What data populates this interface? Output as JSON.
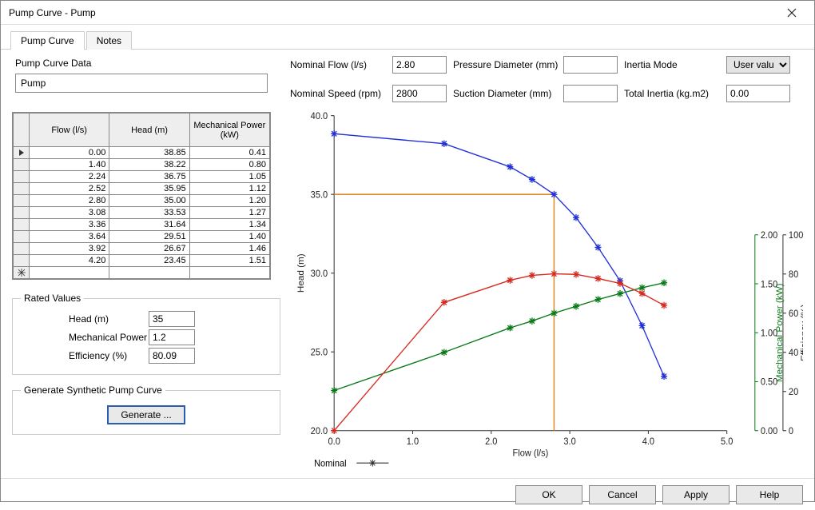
{
  "window": {
    "title": "Pump Curve - Pump"
  },
  "tabs": {
    "curve": "Pump Curve",
    "notes": "Notes"
  },
  "left": {
    "section_label": "Pump Curve Data",
    "name_value": "Pump",
    "grid": {
      "headers": {
        "flow": "Flow (l/s)",
        "head": "Head (m)",
        "power": "Mechanical Power (kW)"
      }
    },
    "rated": {
      "legend": "Rated Values",
      "head_label": "Head (m)",
      "head_value": "35",
      "power_label": "Mechanical Power",
      "power_value": "1.2",
      "eff_label": "Efficiency (%)",
      "eff_value": "80.09"
    },
    "gen": {
      "legend": "Generate Synthetic Pump Curve",
      "button": "Generate ..."
    }
  },
  "params": {
    "nominal_flow_label": "Nominal Flow (l/s)",
    "nominal_flow_value": "2.80",
    "pressure_dia_label": "Pressure Diameter (mm)",
    "pressure_dia_value": "",
    "inertia_mode_label": "Inertia Mode",
    "inertia_mode_value": "User value",
    "nominal_speed_label": "Nominal Speed (rpm)",
    "nominal_speed_value": "2800",
    "suction_dia_label": "Suction Diameter (mm)",
    "suction_dia_value": "",
    "total_inertia_label": "Total Inertia (kg.m2)",
    "total_inertia_value": "0.00"
  },
  "chart": {
    "xlabel": "Flow (l/s)",
    "ylabel_head": "Head (m)",
    "ylabel_power": "Mechanical Power (kW)",
    "ylabel_eff": "Efficiency (%)",
    "legend_nominal": "Nominal"
  },
  "footer": {
    "ok": "OK",
    "cancel": "Cancel",
    "apply": "Apply",
    "help": "Help"
  },
  "chart_data": {
    "type": "line",
    "x": [
      0.0,
      1.4,
      2.24,
      2.52,
      2.8,
      3.08,
      3.36,
      3.64,
      3.92,
      4.2
    ],
    "series": [
      {
        "name": "Head (m)",
        "values": [
          38.85,
          38.22,
          36.75,
          35.95,
          35.0,
          33.53,
          31.64,
          29.51,
          26.67,
          23.45
        ],
        "color": "#2030d8",
        "axis": "left"
      },
      {
        "name": "Mechanical Power (kW)",
        "values": [
          0.41,
          0.8,
          1.05,
          1.12,
          1.2,
          1.27,
          1.34,
          1.4,
          1.46,
          1.51
        ],
        "color": "#0a7a18",
        "axis": "right1"
      },
      {
        "name": "Efficiency (%)",
        "values": [
          0.0,
          65.5,
          76.8,
          79.3,
          80.1,
          79.8,
          77.7,
          75.2,
          70.1,
          64.0
        ],
        "color": "#d62a1f",
        "axis": "right2"
      }
    ],
    "xlim": [
      0.0,
      5.0
    ],
    "ylim_head": [
      20.0,
      40.0
    ],
    "ylim_power": [
      0.0,
      2.0
    ],
    "ylim_eff": [
      0,
      100
    ],
    "nominal_x": 2.8,
    "nominal_head": 35.0,
    "xticks": [
      0.0,
      1.0,
      2.0,
      3.0,
      4.0,
      5.0
    ],
    "yticks_head": [
      20.0,
      25.0,
      30.0,
      35.0,
      40.0
    ],
    "yticks_power": [
      0.0,
      0.5,
      1.0,
      1.5,
      2.0
    ],
    "yticks_eff": [
      0,
      20,
      40,
      60,
      80,
      100
    ]
  }
}
